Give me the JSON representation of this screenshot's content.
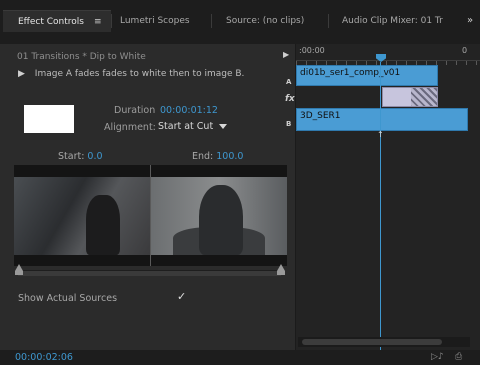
{
  "tabs": {
    "effect_controls": "Effect Controls",
    "menu_icon": "≡",
    "lumetri": "Lumetri Scopes",
    "source": "Source: (no clips)",
    "audio_mixer": "Audio Clip Mixer: 01 Tr",
    "more": "»"
  },
  "effect": {
    "path": "01 Transitions * Dip to White",
    "description": "Image A fades fades to white then to image B.",
    "duration_label": "Duration",
    "duration_value": "00:00:01:12",
    "alignment_label": "Alignment:",
    "alignment_value": "Start at Cut",
    "start_label": "Start:",
    "start_value": "0.0",
    "end_label": "End:",
    "end_value": "100.0",
    "show_sources_label": "Show Actual Sources",
    "show_sources_checked": true,
    "check_glyph": "✓"
  },
  "timeline": {
    "ruler_start": ":00:00",
    "ruler_end": "0",
    "track_a": "A",
    "track_b": "B",
    "fx": "fx",
    "clip_a": "di01b_ser1_comp_v01",
    "clip_b": "3D_SER1"
  },
  "footer": {
    "timecode": "00:00:02:06"
  },
  "icons": {
    "play": "▶",
    "disclosure": "▶",
    "playhead": "playhead-icon",
    "in_arrow": "↑",
    "export": "▷♪",
    "export_frame": "⎙"
  },
  "colors": {
    "accent_blue": "#3e97cf",
    "clip_blue": "#4a9cd4",
    "transition_lavender": "#c7c5dd"
  }
}
